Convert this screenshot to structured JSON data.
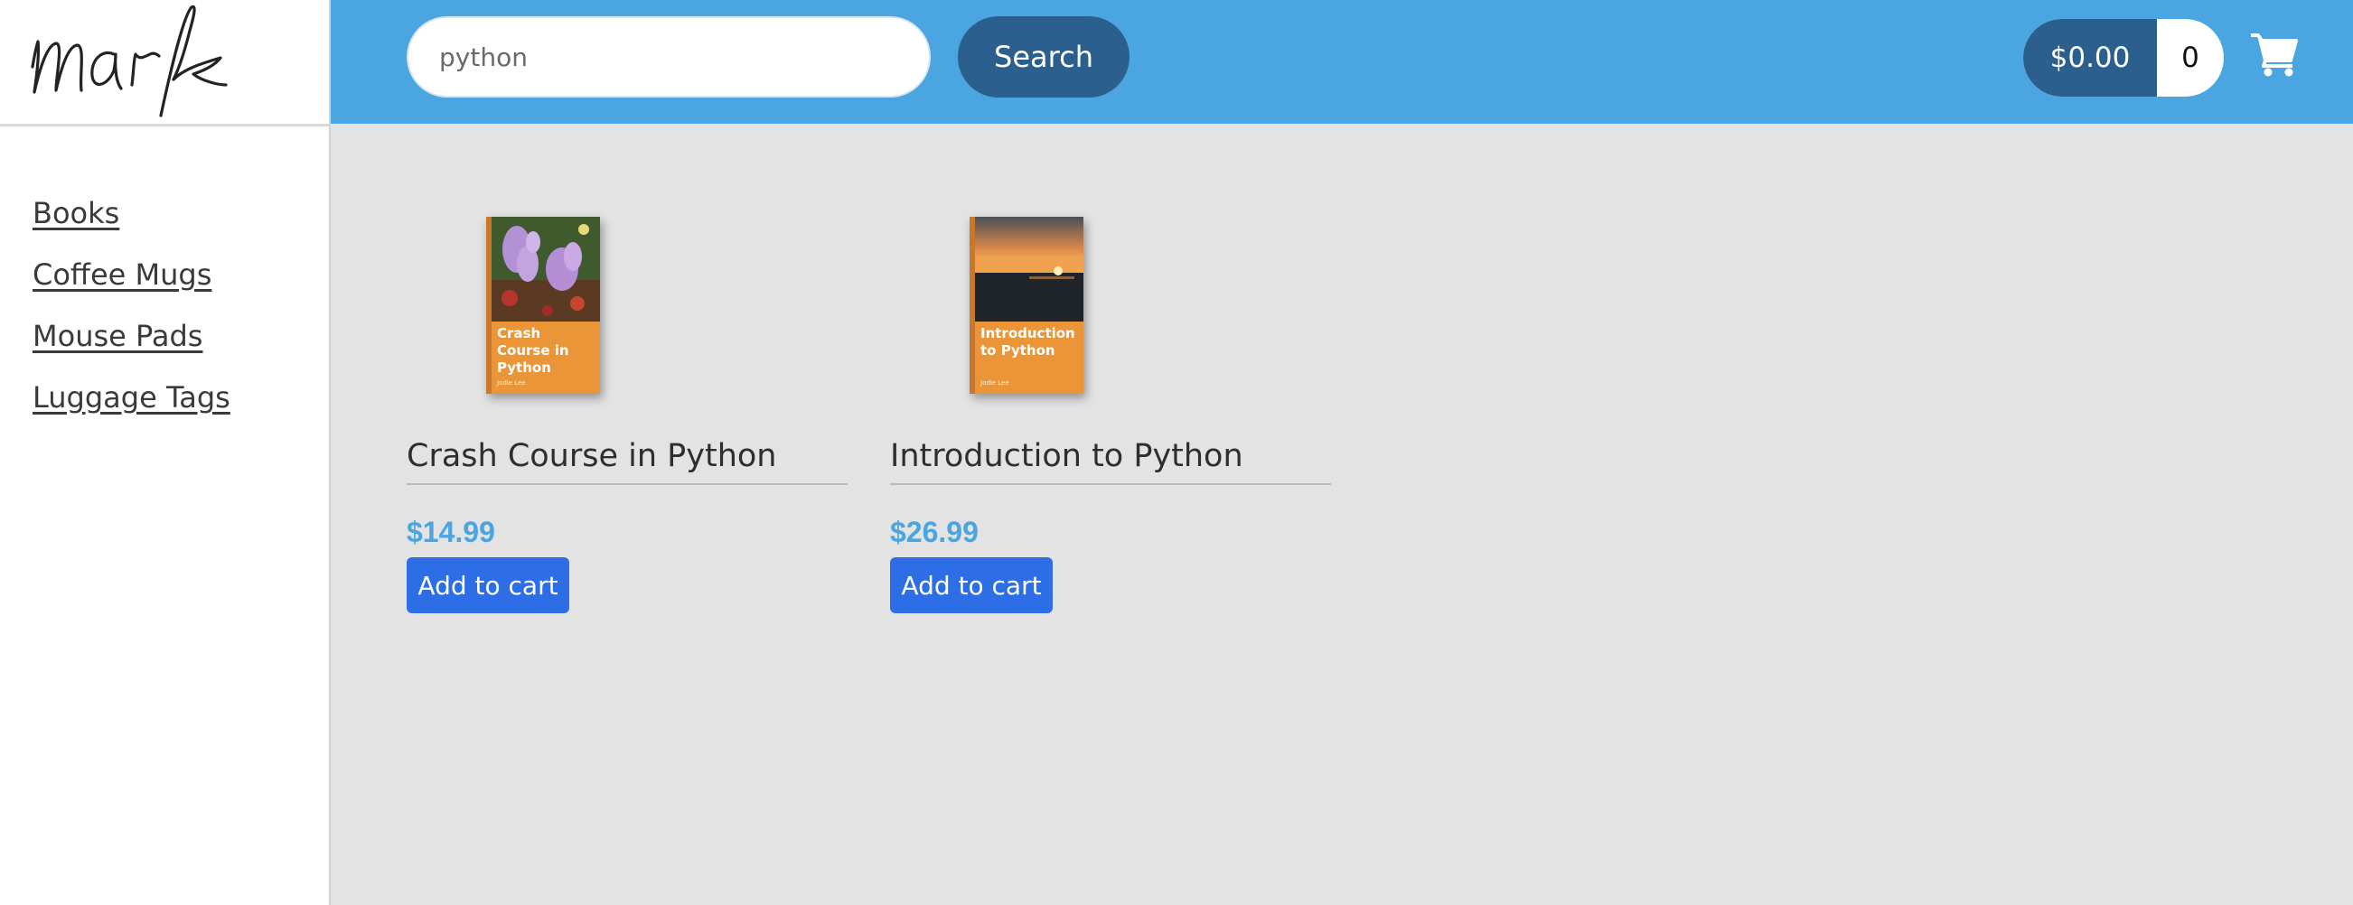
{
  "logo": {
    "text": "mark"
  },
  "search": {
    "value": "python",
    "button_label": "Search"
  },
  "cart": {
    "total": "$0.00",
    "count": "0"
  },
  "sidebar": {
    "items": [
      {
        "label": "Books"
      },
      {
        "label": "Coffee Mugs"
      },
      {
        "label": "Mouse Pads"
      },
      {
        "label": "Luggage Tags"
      }
    ]
  },
  "products": [
    {
      "title": "Crash Course in Python",
      "price": "$14.99",
      "button_label": "Add to cart",
      "cover": {
        "title": "Crash Course in Python",
        "author": "Jodie Lee"
      }
    },
    {
      "title": "Introduction to Python",
      "price": "$26.99",
      "button_label": "Add to cart",
      "cover": {
        "title": "Introduction to Python",
        "author": "Jodie Lee"
      }
    }
  ],
  "colors": {
    "header": "#4aa5e0",
    "accent_dark": "#2b5f8e",
    "price": "#4aa5e0",
    "add_button": "#2d6ee6",
    "content_bg": "#e3e3e3",
    "book_cover": "#ea9537"
  }
}
